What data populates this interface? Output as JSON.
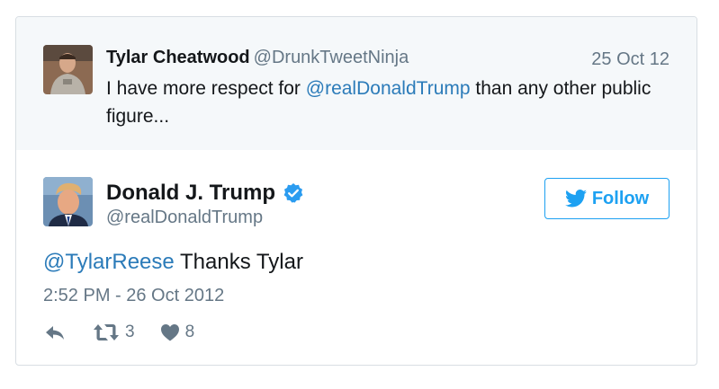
{
  "parent_tweet": {
    "author_name": "Tylar Cheatwood",
    "author_handle": "@DrunkTweetNinja",
    "date": "25 Oct 12",
    "text_before": "I have more respect for ",
    "mention": "@realDonaldTrump",
    "text_after": " than any other public figure..."
  },
  "tweet": {
    "author_name": "Donald J. Trump",
    "author_handle": "@realDonaldTrump",
    "verified_icon": "verified-badge-icon",
    "follow_label": "Follow",
    "mention": "@TylarReese",
    "text": " Thanks Tylar",
    "timestamp": "2:52 PM - 26 Oct 2012",
    "retweet_count": "3",
    "like_count": "8"
  },
  "colors": {
    "accent": "#1da1f2",
    "link": "#2b7bb9",
    "muted": "#657786",
    "parent_bg": "#f5f8fa"
  },
  "icons": [
    "reply-icon",
    "retweet-icon",
    "heart-icon",
    "twitter-bird-icon",
    "verified-badge-icon"
  ]
}
